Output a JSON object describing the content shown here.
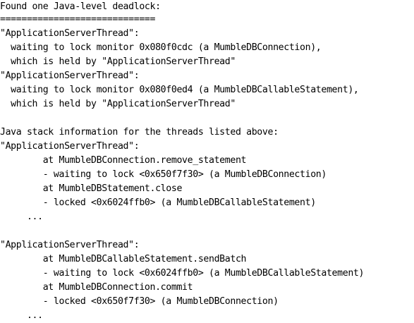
{
  "document": {
    "lines": [
      "Found one Java-level deadlock:",
      "=============================",
      "\"ApplicationServerThread\":",
      "  waiting to lock monitor 0x080f0cdc (a MumbleDBConnection),",
      "  which is held by \"ApplicationServerThread\"",
      "\"ApplicationServerThread\":",
      "  waiting to lock monitor 0x080f0ed4 (a MumbleDBCallableStatement),",
      "  which is held by \"ApplicationServerThread\"",
      "",
      "Java stack information for the threads listed above:",
      "\"ApplicationServerThread\":",
      "        at MumbleDBConnection.remove_statement",
      "        - waiting to lock <0x650f7f30> (a MumbleDBConnection)",
      "        at MumbleDBStatement.close",
      "        - locked <0x6024ffb0> (a MumbleDBCallableStatement)",
      "     ...",
      "",
      "\"ApplicationServerThread\":",
      "        at MumbleDBCallableStatement.sendBatch",
      "        - waiting to lock <0x6024ffb0> (a MumbleDBCallableStatement)",
      "        at MumbleDBConnection.commit",
      "        - locked <0x650f7f30> (a MumbleDBConnection)",
      "     ..."
    ]
  }
}
